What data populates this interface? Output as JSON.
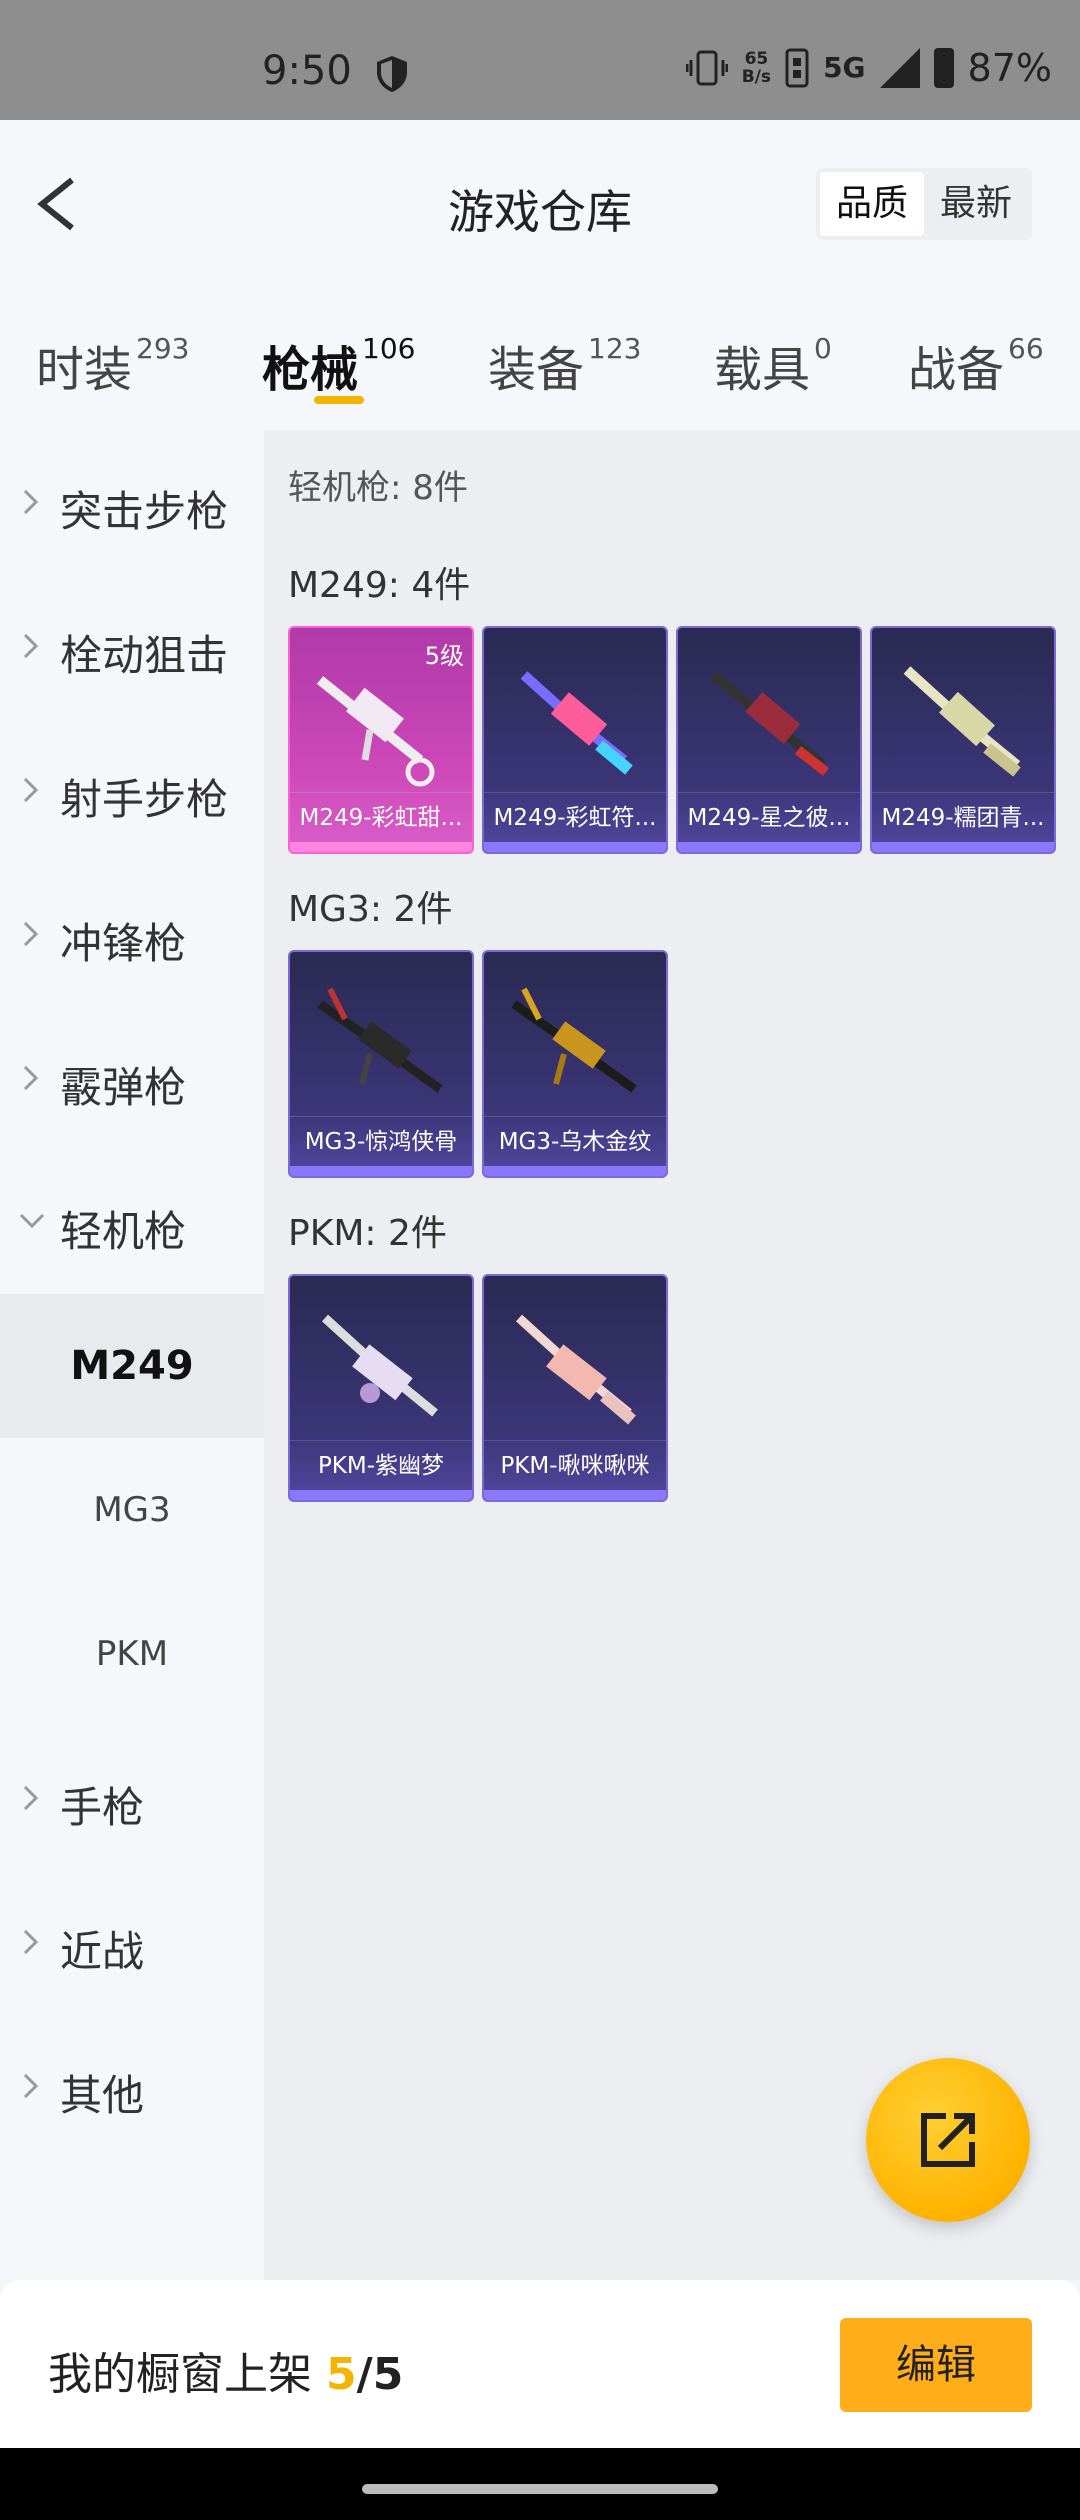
{
  "status_bar": {
    "time": "9:50",
    "net_speed_value": "65",
    "net_speed_unit": "B/s",
    "network": "5G",
    "battery": "87%"
  },
  "header": {
    "title": "游戏仓库",
    "sort_options": [
      "品质",
      "最新"
    ],
    "active_sort": "品质"
  },
  "tabs": [
    {
      "label": "时装",
      "count": "293"
    },
    {
      "label": "枪械",
      "count": "106"
    },
    {
      "label": "装备",
      "count": "123"
    },
    {
      "label": "载具",
      "count": "0"
    },
    {
      "label": "战备",
      "count": "66"
    }
  ],
  "active_tab": "枪械",
  "sidebar": {
    "categories": [
      "突击步枪",
      "栓动狙击",
      "射手步枪",
      "冲锋枪",
      "霰弹枪",
      "轻机枪"
    ],
    "expanded": "轻机枪",
    "subcategories": [
      "M249",
      "MG3",
      "PKM"
    ],
    "active_sub": "M249",
    "more_categories": [
      "手枪",
      "近战",
      "其他"
    ]
  },
  "content": {
    "summary": "轻机枪: 8件",
    "groups": [
      {
        "title": "M249: 4件",
        "items": [
          {
            "name": "M249-彩虹甜...",
            "level": "5级",
            "rarity": "legendary"
          },
          {
            "name": "M249-彩虹符...",
            "rarity": "epic"
          },
          {
            "name": "M249-星之彼...",
            "rarity": "epic"
          },
          {
            "name": "M249-糯团青...",
            "rarity": "epic"
          }
        ]
      },
      {
        "title": "MG3: 2件",
        "items": [
          {
            "name": "MG3-惊鸿侠骨",
            "rarity": "epic"
          },
          {
            "name": "MG3-乌木金纹",
            "rarity": "epic"
          }
        ]
      },
      {
        "title": "PKM: 2件",
        "items": [
          {
            "name": "PKM-紫幽梦",
            "rarity": "epic"
          },
          {
            "name": "PKM-啾咪啾咪",
            "rarity": "epic"
          }
        ]
      }
    ]
  },
  "bottom_bar": {
    "label": "我的橱窗上架",
    "current": "5",
    "separator": "/",
    "total": "5",
    "edit_label": "编辑"
  },
  "colors": {
    "accent": "#f5b400",
    "edit_button": "#ffad18",
    "legendary_card": "#cc47b8",
    "epic_card": "#3b3577"
  },
  "icons": {
    "back": "chevron-left-icon",
    "share": "external-link-icon",
    "shield": "shield-icon",
    "category_collapsed": "chevron-right-icon",
    "category_expanded": "chevron-down-icon"
  }
}
